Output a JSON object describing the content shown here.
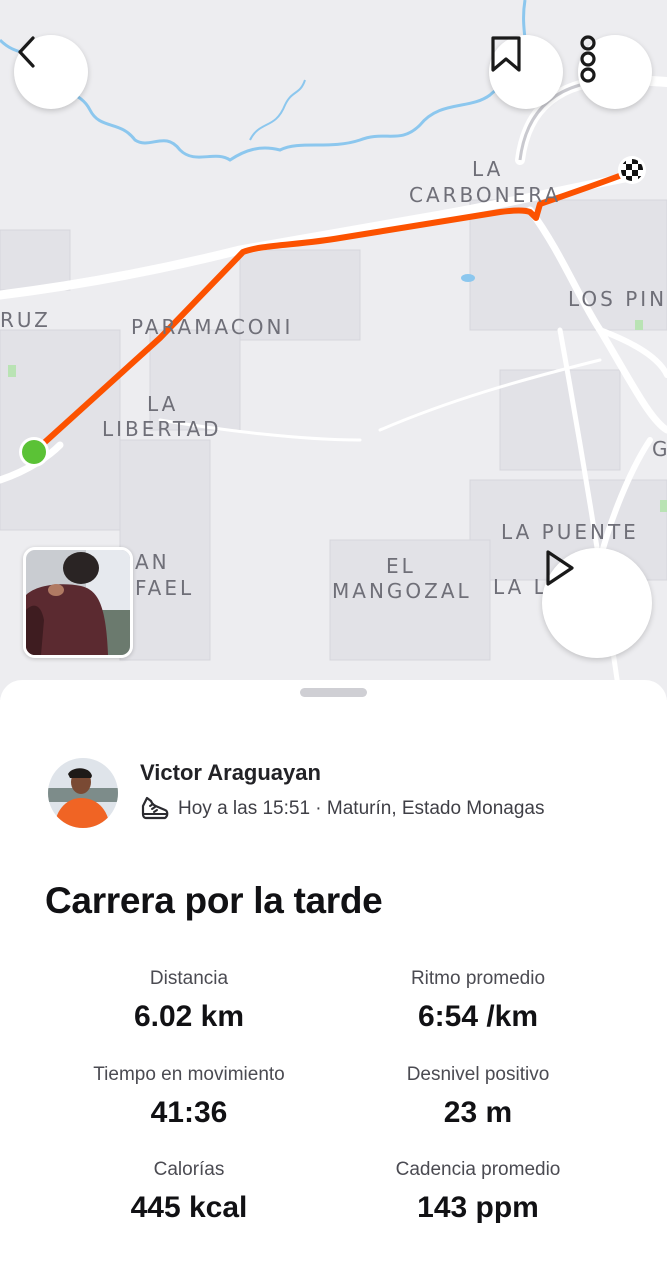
{
  "map": {
    "labels": {
      "la": "LA",
      "carbonera": "CARBONERA",
      "los_pin": "LOS PIN",
      "ruz": "RUZ",
      "paramaconi": "PARAMACONI",
      "la2": "LA",
      "libertad": "LIBERTAD",
      "g": "G",
      "la_puente": "LA PUENTE",
      "an": "AN",
      "fael": "FAEL",
      "el": "EL",
      "mangozal": "MANGOZAL",
      "la_l": "LA L"
    },
    "route_color": "#fc5200",
    "start_color": "#5bc236"
  },
  "buttons": {
    "back_icon": "chevron-left-icon",
    "save_icon": "bookmark-icon",
    "more_icon": "vertical-dots-icon",
    "play_icon": "play-icon"
  },
  "athlete": {
    "name": "Victor Araguayan",
    "meta": "Hoy a las 15:51 · Maturín, Estado Monagas",
    "activity_icon": "running-shoe-icon"
  },
  "activity": {
    "title": "Carrera por la tarde"
  },
  "stats": [
    {
      "label": "Distancia",
      "value": "6.02 km"
    },
    {
      "label": "Ritmo promedio",
      "value": "6:54 /km"
    },
    {
      "label": "Tiempo en movimiento",
      "value": "41:36"
    },
    {
      "label": "Desnivel positivo",
      "value": "23 m"
    },
    {
      "label": "Calorías",
      "value": "445 kcal"
    },
    {
      "label": "Cadencia promedio",
      "value": "143 ppm"
    }
  ]
}
